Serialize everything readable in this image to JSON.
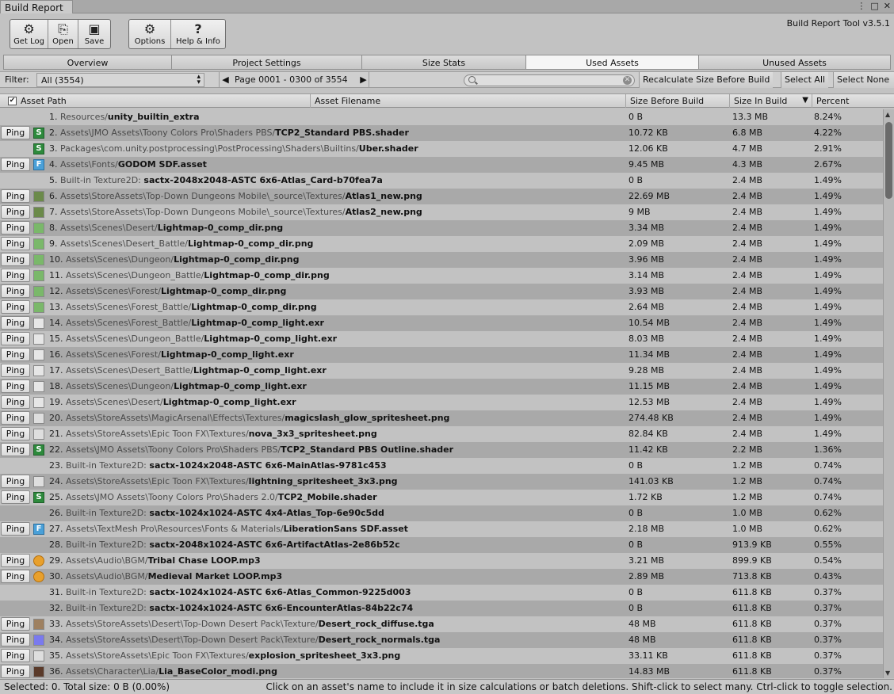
{
  "window": {
    "title": "Build Report"
  },
  "toolbar": {
    "group1": [
      {
        "label": "Get Log",
        "icon": "get-log-icon"
      },
      {
        "label": "Open",
        "icon": "open-icon"
      },
      {
        "label": "Save",
        "icon": "save-icon"
      }
    ],
    "group2": [
      {
        "label": "Options",
        "icon": "gear-icon"
      },
      {
        "label": "Help & Info",
        "icon": "help-icon"
      }
    ],
    "version": "Build Report Tool v3.5.1"
  },
  "tabs": [
    {
      "label": "Overview",
      "active": false
    },
    {
      "label": "Project Settings",
      "active": false
    },
    {
      "label": "Size Stats",
      "active": false
    },
    {
      "label": "Used Assets",
      "active": true
    },
    {
      "label": "Unused Assets",
      "active": false
    }
  ],
  "filterbar": {
    "filter_label": "Filter:",
    "filter_value": "All (3554)",
    "page_label": "Page 0001 - 0300 of 3554",
    "search_placeholder": "",
    "recalculate_label": "Recalculate Size Before Build",
    "select_all_label": "Select All",
    "select_none_label": "Select None"
  },
  "columns": {
    "asset_path": "Asset Path",
    "asset_filename": "Asset Filename",
    "size_before": "Size Before Build",
    "size_in_build": "Size In Build",
    "sort_indicator": "▼",
    "percent": "Percent"
  },
  "ping_label": "Ping",
  "rows": [
    {
      "num": "1.",
      "path": "Resources/",
      "file": "unity_builtin_extra",
      "before": "0 B",
      "inbuild": "13.3 MB",
      "pct": "8.24%",
      "ping": false,
      "icon": ""
    },
    {
      "num": "2.",
      "path": "Assets\\JMO Assets\\Toony Colors Pro\\Shaders PBS/",
      "file": "TCP2_Standard PBS.shader",
      "before": "10.72 KB",
      "inbuild": "6.8 MB",
      "pct": "4.22%",
      "ping": true,
      "icon": "script"
    },
    {
      "num": "3.",
      "path": "Packages\\com.unity.postprocessing\\PostProcessing\\Shaders\\Builtins/",
      "file": "Uber.shader",
      "before": "12.06 KB",
      "inbuild": "4.7 MB",
      "pct": "2.91%",
      "ping": false,
      "icon": "script"
    },
    {
      "num": "4.",
      "path": "Assets\\Fonts/",
      "file": "GODOM SDF.asset",
      "before": "9.45 MB",
      "inbuild": "4.3 MB",
      "pct": "2.67%",
      "ping": true,
      "icon": "font"
    },
    {
      "num": "5.",
      "path": "Built-in Texture2D: ",
      "file": "sactx-2048x2048-ASTC 6x6-Atlas_Card-b70fea7a",
      "before": "0 B",
      "inbuild": "2.4 MB",
      "pct": "1.49%",
      "ping": false,
      "icon": ""
    },
    {
      "num": "6.",
      "path": "Assets\\StoreAssets\\Top-Down Dungeons Mobile\\_source\\Textures/",
      "file": "Atlas1_new.png",
      "before": "22.69 MB",
      "inbuild": "2.4 MB",
      "pct": "1.49%",
      "ping": true,
      "icon": "tex"
    },
    {
      "num": "7.",
      "path": "Assets\\StoreAssets\\Top-Down Dungeons Mobile\\_source\\Textures/",
      "file": "Atlas2_new.png",
      "before": "9 MB",
      "inbuild": "2.4 MB",
      "pct": "1.49%",
      "ping": true,
      "icon": "tex"
    },
    {
      "num": "8.",
      "path": "Assets\\Scenes\\Desert/",
      "file": "Lightmap-0_comp_dir.png",
      "before": "3.34 MB",
      "inbuild": "2.4 MB",
      "pct": "1.49%",
      "ping": true,
      "icon": "lmap"
    },
    {
      "num": "9.",
      "path": "Assets\\Scenes\\Desert_Battle/",
      "file": "Lightmap-0_comp_dir.png",
      "before": "2.09 MB",
      "inbuild": "2.4 MB",
      "pct": "1.49%",
      "ping": true,
      "icon": "lmap"
    },
    {
      "num": "10.",
      "path": "Assets\\Scenes\\Dungeon/",
      "file": "Lightmap-0_comp_dir.png",
      "before": "3.96 MB",
      "inbuild": "2.4 MB",
      "pct": "1.49%",
      "ping": true,
      "icon": "lmap"
    },
    {
      "num": "11.",
      "path": "Assets\\Scenes\\Dungeon_Battle/",
      "file": "Lightmap-0_comp_dir.png",
      "before": "3.14 MB",
      "inbuild": "2.4 MB",
      "pct": "1.49%",
      "ping": true,
      "icon": "lmap"
    },
    {
      "num": "12.",
      "path": "Assets\\Scenes\\Forest/",
      "file": "Lightmap-0_comp_dir.png",
      "before": "3.93 MB",
      "inbuild": "2.4 MB",
      "pct": "1.49%",
      "ping": true,
      "icon": "lmap"
    },
    {
      "num": "13.",
      "path": "Assets\\Scenes\\Forest_Battle/",
      "file": "Lightmap-0_comp_dir.png",
      "before": "2.64 MB",
      "inbuild": "2.4 MB",
      "pct": "1.49%",
      "ping": true,
      "icon": "lmap"
    },
    {
      "num": "14.",
      "path": "Assets\\Scenes\\Forest_Battle/",
      "file": "Lightmap-0_comp_light.exr",
      "before": "10.54 MB",
      "inbuild": "2.4 MB",
      "pct": "1.49%",
      "ping": true,
      "icon": "exr"
    },
    {
      "num": "15.",
      "path": "Assets\\Scenes\\Dungeon_Battle/",
      "file": "Lightmap-0_comp_light.exr",
      "before": "8.03 MB",
      "inbuild": "2.4 MB",
      "pct": "1.49%",
      "ping": true,
      "icon": "exr"
    },
    {
      "num": "16.",
      "path": "Assets\\Scenes\\Forest/",
      "file": "Lightmap-0_comp_light.exr",
      "before": "11.34 MB",
      "inbuild": "2.4 MB",
      "pct": "1.49%",
      "ping": true,
      "icon": "exr"
    },
    {
      "num": "17.",
      "path": "Assets\\Scenes\\Desert_Battle/",
      "file": "Lightmap-0_comp_light.exr",
      "before": "9.28 MB",
      "inbuild": "2.4 MB",
      "pct": "1.49%",
      "ping": true,
      "icon": "exr"
    },
    {
      "num": "18.",
      "path": "Assets\\Scenes\\Dungeon/",
      "file": "Lightmap-0_comp_light.exr",
      "before": "11.15 MB",
      "inbuild": "2.4 MB",
      "pct": "1.49%",
      "ping": true,
      "icon": "exr"
    },
    {
      "num": "19.",
      "path": "Assets\\Scenes\\Desert/",
      "file": "Lightmap-0_comp_light.exr",
      "before": "12.53 MB",
      "inbuild": "2.4 MB",
      "pct": "1.49%",
      "ping": true,
      "icon": "exr"
    },
    {
      "num": "20.",
      "path": "Assets\\StoreAssets\\MagicArsenal\\Effects\\Textures/",
      "file": "magicslash_glow_spritesheet.png",
      "before": "274.48 KB",
      "inbuild": "2.4 MB",
      "pct": "1.49%",
      "ping": true,
      "icon": "fx"
    },
    {
      "num": "21.",
      "path": "Assets\\StoreAssets\\Epic Toon FX\\Textures/",
      "file": "nova_3x3_spritesheet.png",
      "before": "82.84 KB",
      "inbuild": "2.4 MB",
      "pct": "1.49%",
      "ping": true,
      "icon": "fx"
    },
    {
      "num": "22.",
      "path": "Assets\\JMO Assets\\Toony Colors Pro\\Shaders PBS/",
      "file": "TCP2_Standard PBS Outline.shader",
      "before": "11.42 KB",
      "inbuild": "2.2 MB",
      "pct": "1.36%",
      "ping": true,
      "icon": "script"
    },
    {
      "num": "23.",
      "path": "Built-in Texture2D: ",
      "file": "sactx-1024x2048-ASTC 6x6-MainAtlas-9781c453",
      "before": "0 B",
      "inbuild": "1.2 MB",
      "pct": "0.74%",
      "ping": false,
      "icon": ""
    },
    {
      "num": "24.",
      "path": "Assets\\StoreAssets\\Epic Toon FX\\Textures/",
      "file": "lightning_spritesheet_3x3.png",
      "before": "141.03 KB",
      "inbuild": "1.2 MB",
      "pct": "0.74%",
      "ping": true,
      "icon": "fx"
    },
    {
      "num": "25.",
      "path": "Assets\\JMO Assets\\Toony Colors Pro\\Shaders 2.0/",
      "file": "TCP2_Mobile.shader",
      "before": "1.72 KB",
      "inbuild": "1.2 MB",
      "pct": "0.74%",
      "ping": true,
      "icon": "script"
    },
    {
      "num": "26.",
      "path": "Built-in Texture2D: ",
      "file": "sactx-1024x1024-ASTC 4x4-Atlas_Top-6e90c5dd",
      "before": "0 B",
      "inbuild": "1.0 MB",
      "pct": "0.62%",
      "ping": false,
      "icon": ""
    },
    {
      "num": "27.",
      "path": "Assets\\TextMesh Pro\\Resources\\Fonts & Materials/",
      "file": "LiberationSans SDF.asset",
      "before": "2.18 MB",
      "inbuild": "1.0 MB",
      "pct": "0.62%",
      "ping": true,
      "icon": "font"
    },
    {
      "num": "28.",
      "path": "Built-in Texture2D: ",
      "file": "sactx-2048x1024-ASTC 6x6-ArtifactAtlas-2e86b52c",
      "before": "0 B",
      "inbuild": "913.9 KB",
      "pct": "0.55%",
      "ping": false,
      "icon": ""
    },
    {
      "num": "29.",
      "path": "Assets\\Audio\\BGM/",
      "file": "Tribal Chase LOOP.mp3",
      "before": "3.21 MB",
      "inbuild": "899.9 KB",
      "pct": "0.54%",
      "ping": true,
      "icon": "audio"
    },
    {
      "num": "30.",
      "path": "Assets\\Audio\\BGM/",
      "file": "Medieval Market LOOP.mp3",
      "before": "2.89 MB",
      "inbuild": "713.8 KB",
      "pct": "0.43%",
      "ping": true,
      "icon": "audio"
    },
    {
      "num": "31.",
      "path": "Built-in Texture2D: ",
      "file": "sactx-1024x1024-ASTC 6x6-Atlas_Common-9225d003",
      "before": "0 B",
      "inbuild": "611.8 KB",
      "pct": "0.37%",
      "ping": false,
      "icon": ""
    },
    {
      "num": "32.",
      "path": "Built-in Texture2D: ",
      "file": "sactx-1024x1024-ASTC 6x6-EncounterAtlas-84b22c74",
      "before": "0 B",
      "inbuild": "611.8 KB",
      "pct": "0.37%",
      "ping": false,
      "icon": ""
    },
    {
      "num": "33.",
      "path": "Assets\\StoreAssets\\Desert\\Top-Down Desert Pack\\Texture/",
      "file": "Desert_rock_diffuse.tga",
      "before": "48 MB",
      "inbuild": "611.8 KB",
      "pct": "0.37%",
      "ping": true,
      "icon": "rock"
    },
    {
      "num": "34.",
      "path": "Assets\\StoreAssets\\Desert\\Top-Down Desert Pack\\Texture/",
      "file": "Desert_rock_normals.tga",
      "before": "48 MB",
      "inbuild": "611.8 KB",
      "pct": "0.37%",
      "ping": true,
      "icon": "norm"
    },
    {
      "num": "35.",
      "path": "Assets\\StoreAssets\\Epic Toon FX\\Textures/",
      "file": "explosion_spritesheet_3x3.png",
      "before": "33.11 KB",
      "inbuild": "611.8 KB",
      "pct": "0.37%",
      "ping": true,
      "icon": "fx"
    },
    {
      "num": "36.",
      "path": "Assets\\Character\\Lia/",
      "file": "Lia_BaseColor_modi.png",
      "before": "14.83 MB",
      "inbuild": "611.8 KB",
      "pct": "0.37%",
      "ping": true,
      "icon": "char"
    }
  ],
  "status": {
    "left": "Selected: 0. Total size: 0 B (0.00%)",
    "right": "Click on an asset's name to include it in size calculations or batch deletions. Shift-click to select many. Ctrl-click to toggle selection."
  }
}
